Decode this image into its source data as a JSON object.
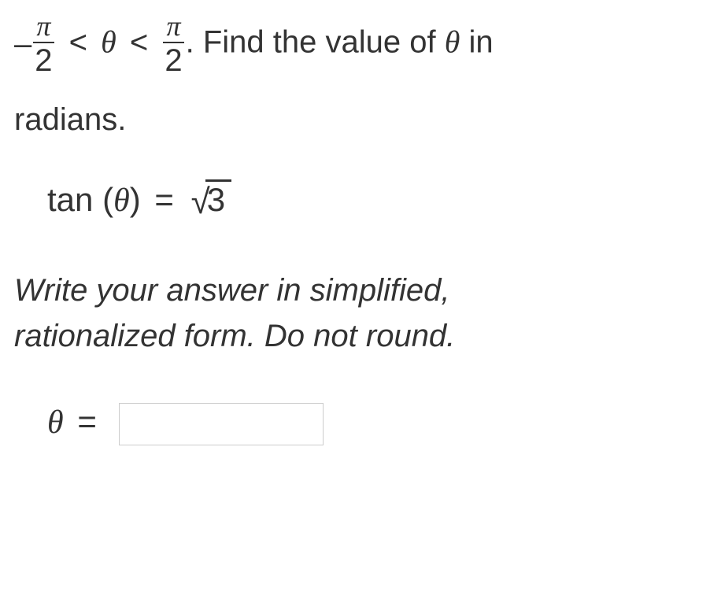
{
  "problem": {
    "range_minus": "–",
    "pi": "π",
    "two": "2",
    "lt1": "<",
    "theta": "θ",
    "lt2": "<",
    "period": ".",
    "text_after": " Find the value of ",
    "text_in": " in",
    "text_radians": "radians."
  },
  "equation": {
    "fn": "tan",
    "lparen": "(",
    "theta": "θ",
    "rparen": ")",
    "eq": "=",
    "sqrt_content": "3"
  },
  "instruction": {
    "line1": "Write your answer in simplified,",
    "line2": "rationalized form. Do not round."
  },
  "answer": {
    "theta": "θ",
    "eq": "=",
    "value": "",
    "placeholder": ""
  }
}
